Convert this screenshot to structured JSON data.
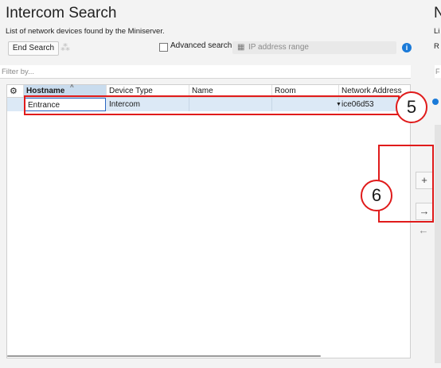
{
  "header": {
    "title": "Intercom Search",
    "subtitle": "List of network devices found by the Miniserver."
  },
  "toolbar": {
    "end_search_label": "End Search",
    "spinner_glyph": "⁂",
    "advanced_search_label": "Advanced search:",
    "ip_placeholder": "IP address range",
    "info_icon": "i"
  },
  "filter": {
    "placeholder": "Filter by..."
  },
  "table": {
    "settings_icon": "⚙",
    "columns": [
      "Hostname",
      "Device Type",
      "Name",
      "Room",
      "Network Address"
    ],
    "rows": [
      {
        "hostname": "Entrance",
        "device_type": "Intercom",
        "name": "",
        "room": "",
        "network_address": "ice06d53"
      }
    ]
  },
  "side_buttons": {
    "add": "+",
    "move_right": "→",
    "move_left": "←"
  },
  "annotations": {
    "callout_5": "5",
    "callout_6": "6"
  },
  "right_panel": {
    "title_fragment": "N",
    "subtitle_fragment": "Li",
    "row_fragment": "R",
    "filter_fragment": "F"
  },
  "colors": {
    "accent": "#1a7ad8",
    "callout": "#e01b1b",
    "selection": "#dce9f6",
    "sorted_header": "#c9dcee"
  }
}
